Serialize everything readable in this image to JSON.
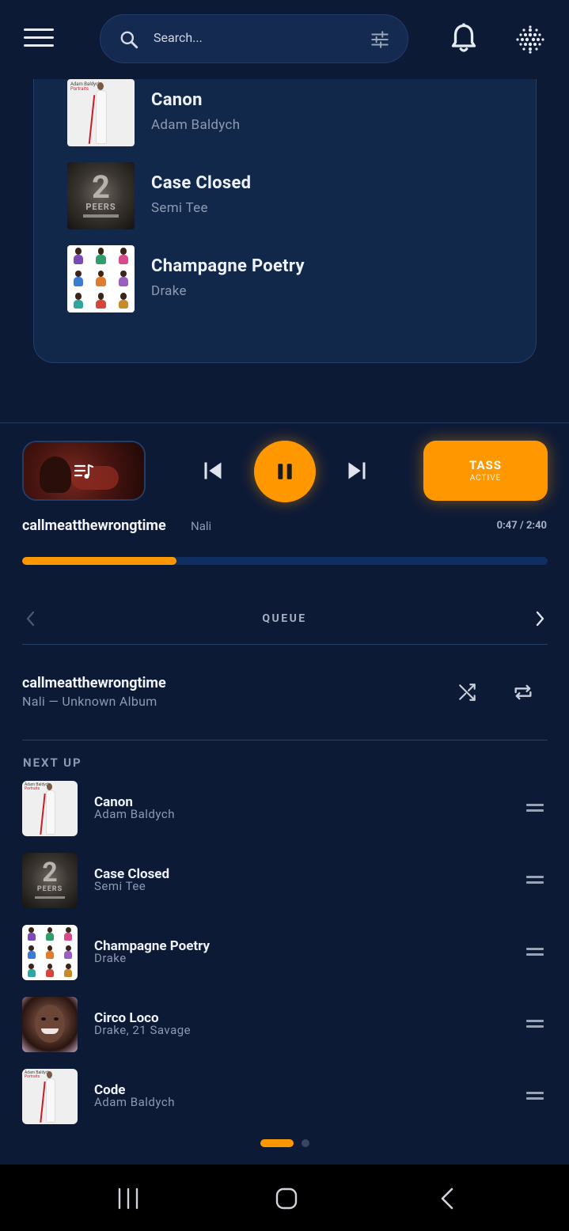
{
  "search": {
    "placeholder": "Search..."
  },
  "search_results": [
    {
      "title": "Canon",
      "artist": "Adam Baldych",
      "art": "portraits"
    },
    {
      "title": "Case Closed",
      "artist": "Semi Tee",
      "art": "peers"
    },
    {
      "title": "Champagne Poetry",
      "artist": "Drake",
      "art": "champagne"
    }
  ],
  "player": {
    "title": "callmeatthewrongtime",
    "artist": "Nali",
    "time": "0:47 / 2:40",
    "progress_fraction": 0.294,
    "tass": {
      "label": "TASS",
      "status": "ACTIVE"
    }
  },
  "queue": {
    "label": "QUEUE",
    "current": {
      "title": "callmeatthewrongtime",
      "subtitle": "Nali — Unknown Album"
    },
    "next_up_label": "NEXT UP",
    "items": [
      {
        "title": "Canon",
        "artist": "Adam Baldych",
        "art": "portraits"
      },
      {
        "title": "Case Closed",
        "artist": "Semi Tee",
        "art": "peers"
      },
      {
        "title": "Champagne Poetry",
        "artist": "Drake",
        "art": "champagne"
      },
      {
        "title": "Circo Loco",
        "artist": "Drake, 21 Savage",
        "art": "circo"
      },
      {
        "title": "Code",
        "artist": "Adam Baldych",
        "art": "portraits"
      }
    ]
  },
  "album_art_text": {
    "portraits_artist": "Adam Baldych",
    "portraits_title": "Portraits",
    "peers_text": "PEERS"
  },
  "colors": {
    "accent": "#ff9800",
    "background": "#0d1a36",
    "panel": "#12284a"
  }
}
